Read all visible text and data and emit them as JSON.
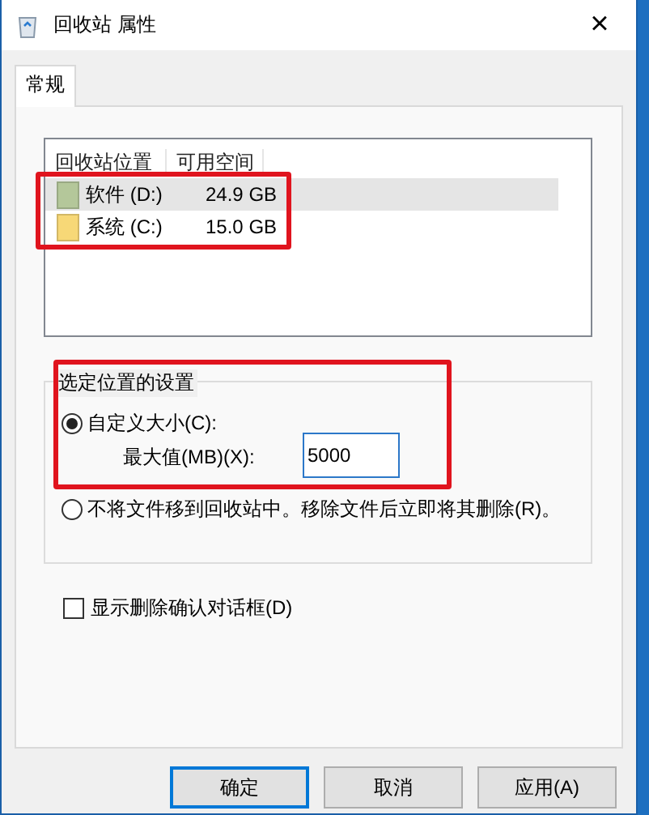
{
  "window": {
    "title": "回收站 属性",
    "close": "×"
  },
  "tabs": [
    {
      "label": "常规",
      "selected": true
    }
  ],
  "drive_list": {
    "columns": [
      "回收站位置",
      "可用空间"
    ],
    "highlighted": true,
    "rows": [
      {
        "name": "软件 (D:)",
        "free": "24.9 GB",
        "selected": true,
        "color": "#b4c79a"
      },
      {
        "name": "系统 (C:)",
        "free": "15.0 GB",
        "selected": false,
        "color": "#f7d877"
      }
    ]
  },
  "settings": {
    "title": "选定位置的设置",
    "highlighted": true,
    "options": [
      {
        "label": "自定义大小(C):",
        "selected": true
      },
      {
        "label": "不将文件移到回收站中。移除文件后立即将其删除(R)。",
        "selected": false
      }
    ],
    "max_size": {
      "label": "最大值(MB)(X):",
      "value": "5000"
    }
  },
  "confirm": {
    "label": "显示删除确认对话框(D)",
    "checked": false
  },
  "buttons": [
    {
      "label": "确定",
      "default": true
    },
    {
      "label": "取消",
      "default": false
    },
    {
      "label": "应用(A)",
      "default": false
    }
  ]
}
